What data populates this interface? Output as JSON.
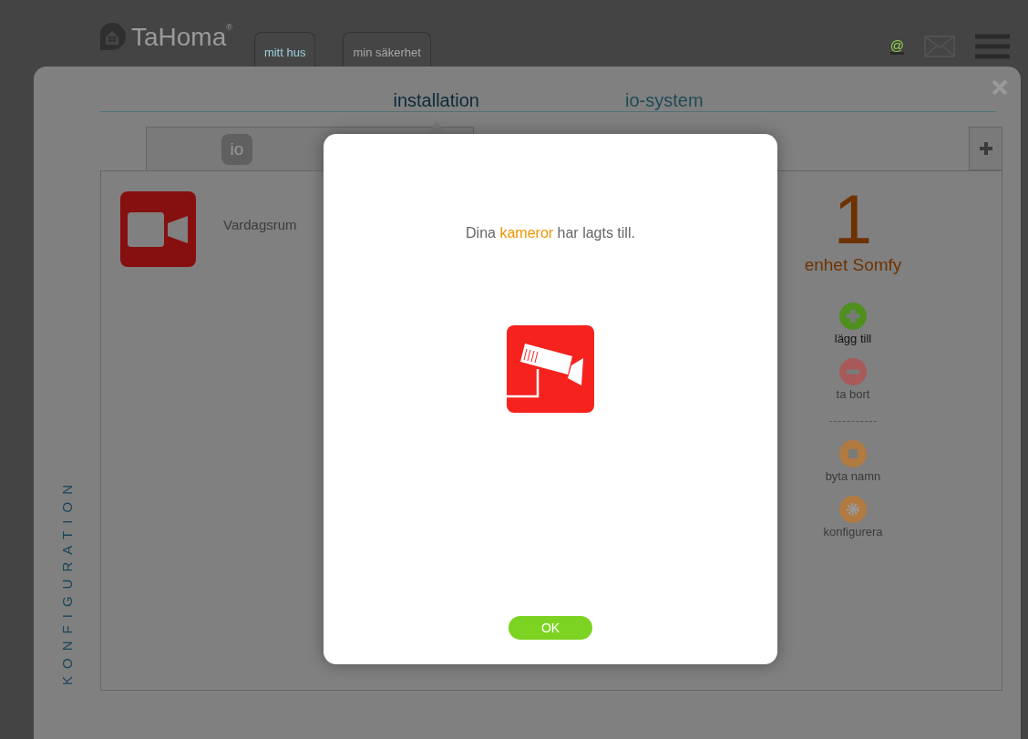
{
  "header": {
    "logo": "TaHoma",
    "logo_mark": "®",
    "network_symbol": "@",
    "nav_tabs": [
      {
        "label": "mitt hus",
        "selected": true
      },
      {
        "label": "min säkerhet",
        "selected": false
      }
    ]
  },
  "panel": {
    "tabs": [
      {
        "label": "installation",
        "selected": true
      },
      {
        "label": "io-system",
        "selected": false
      }
    ],
    "side_label": "KONFIGURATION",
    "protocol_tab": {
      "label": "io"
    },
    "devices": [
      {
        "name": "Vardagsrum"
      }
    ],
    "count": {
      "value": "1",
      "label": "enhet Somfy"
    },
    "action_groups": [
      [
        {
          "kind": "add",
          "label": "lägg till",
          "disabled": false
        },
        {
          "kind": "remove",
          "label": "ta bort",
          "disabled": true
        }
      ],
      [
        {
          "kind": "rename",
          "label": "byta namn",
          "disabled": true
        },
        {
          "kind": "configure",
          "label": "konfigurera",
          "disabled": true
        }
      ]
    ]
  },
  "dialog": {
    "message": {
      "before": "Dina ",
      "highlight": "kameror",
      "after": " har lagts till."
    },
    "ok_button": "OK"
  }
}
